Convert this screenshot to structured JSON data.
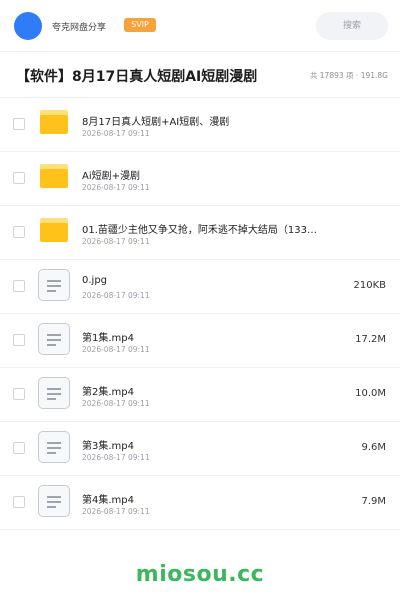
{
  "header": {
    "site_name": "夸克网盘分享",
    "svip_badge": "SVIP",
    "search_placeholder": "搜索"
  },
  "share": {
    "title": "【软件】8月17日真人短剧AI短剧漫剧",
    "item_count": "共 17893 项",
    "separator": " · ",
    "total_size": "191.8G"
  },
  "files": [
    {
      "type": "folder",
      "name": "8月17日真人短剧+AI短剧、漫剧",
      "date": "2026-08-17 09:11",
      "size": ""
    },
    {
      "type": "folder",
      "name": "Ai短剧+漫剧",
      "date": "2026-08-17 09:11",
      "size": ""
    },
    {
      "type": "folder",
      "name": "01.苗疆少主他又争又抢，阿禾逃不掉大结局（133…",
      "date": "2026-08-17 09:11",
      "size": ""
    },
    {
      "type": "file",
      "name": "0.jpg",
      "date": "2026-08-17 09:11",
      "size": "210KB"
    },
    {
      "type": "file",
      "name": "第1集.mp4",
      "date": "2026-08-17 09:11",
      "size": "17.2M"
    },
    {
      "type": "file",
      "name": "第2集.mp4",
      "date": "2026-08-17 09:11",
      "size": "10.0M"
    },
    {
      "type": "file",
      "name": "第3集.mp4",
      "date": "2026-08-17 09:11",
      "size": "9.6M"
    },
    {
      "type": "file",
      "name": "第4集.mp4",
      "date": "2026-08-17 09:11",
      "size": "7.9M"
    }
  ],
  "watermark": "miosou.cc",
  "colors": {
    "accent": "#2f7cf6",
    "svip": "#f8a23b",
    "folder": "#ffc21a",
    "watermark": "#3cb85c"
  }
}
